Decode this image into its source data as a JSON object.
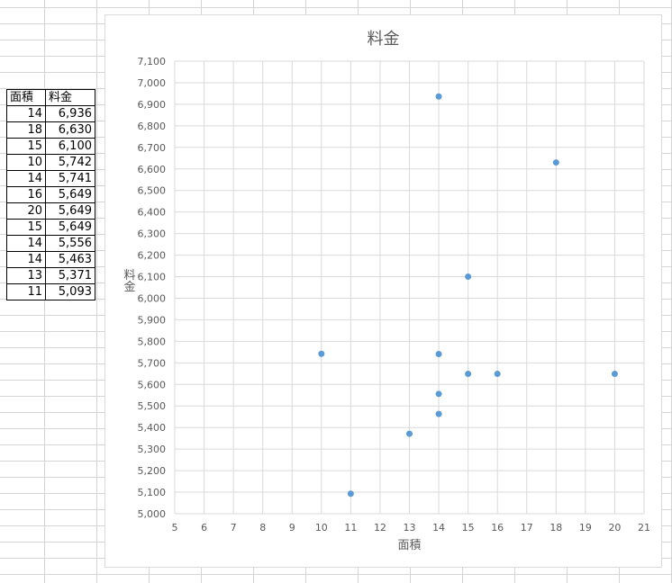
{
  "table": {
    "headers": [
      "面積",
      "料金"
    ],
    "rows": [
      [
        "14",
        "6,936"
      ],
      [
        "18",
        "6,630"
      ],
      [
        "15",
        "6,100"
      ],
      [
        "10",
        "5,742"
      ],
      [
        "14",
        "5,741"
      ],
      [
        "16",
        "5,649"
      ],
      [
        "20",
        "5,649"
      ],
      [
        "15",
        "5,649"
      ],
      [
        "14",
        "5,556"
      ],
      [
        "14",
        "5,463"
      ],
      [
        "13",
        "5,371"
      ],
      [
        "11",
        "5,093"
      ]
    ]
  },
  "chart_data": {
    "type": "scatter",
    "title": "料金",
    "xlabel": "面積",
    "ylabel": "料金",
    "xlim": [
      5,
      21
    ],
    "ylim": [
      5000,
      7100
    ],
    "x_ticks": [
      "5",
      "6",
      "7",
      "8",
      "9",
      "10",
      "11",
      "12",
      "13",
      "14",
      "15",
      "16",
      "17",
      "18",
      "19",
      "20",
      "21"
    ],
    "y_ticks": [
      "5,000",
      "5,100",
      "5,200",
      "5,300",
      "5,400",
      "5,500",
      "5,600",
      "5,700",
      "5,800",
      "5,900",
      "6,000",
      "6,100",
      "6,200",
      "6,300",
      "6,400",
      "6,500",
      "6,600",
      "6,700",
      "6,800",
      "6,900",
      "7,000",
      "7,100"
    ],
    "grid": true,
    "marker_color": "#5b9bd5",
    "points": [
      {
        "x": 14,
        "y": 6936
      },
      {
        "x": 18,
        "y": 6630
      },
      {
        "x": 15,
        "y": 6100
      },
      {
        "x": 10,
        "y": 5742
      },
      {
        "x": 14,
        "y": 5741
      },
      {
        "x": 16,
        "y": 5649
      },
      {
        "x": 20,
        "y": 5649
      },
      {
        "x": 15,
        "y": 5649
      },
      {
        "x": 14,
        "y": 5556
      },
      {
        "x": 14,
        "y": 5463
      },
      {
        "x": 13,
        "y": 5371
      },
      {
        "x": 11,
        "y": 5093
      }
    ]
  }
}
